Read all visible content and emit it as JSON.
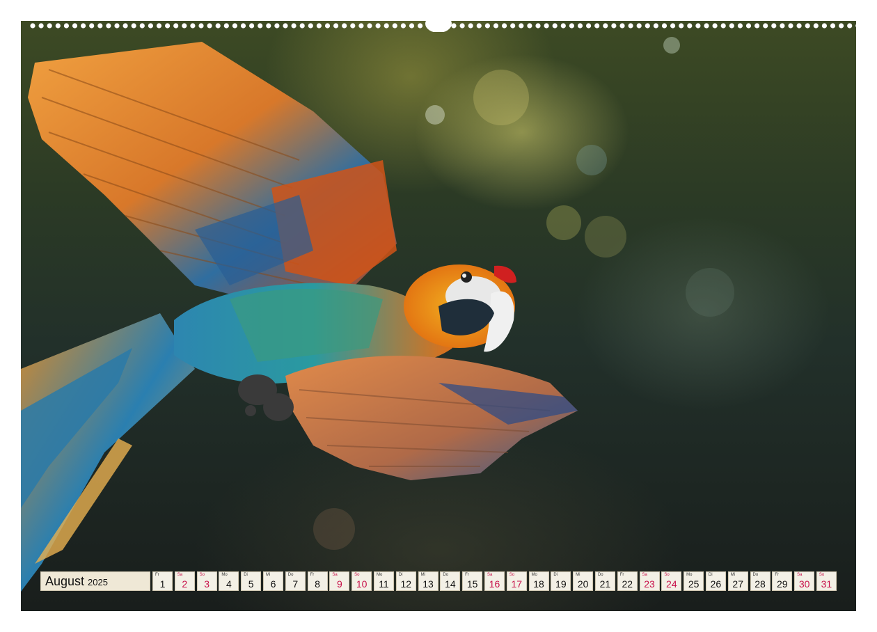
{
  "calendar": {
    "month": "August",
    "year": "2025",
    "weekend_color": "#c8104a",
    "days": [
      {
        "wd": "Fr",
        "num": "1",
        "weekend": false
      },
      {
        "wd": "Sa",
        "num": "2",
        "weekend": true
      },
      {
        "wd": "So",
        "num": "3",
        "weekend": true
      },
      {
        "wd": "Mo",
        "num": "4",
        "weekend": false
      },
      {
        "wd": "Di",
        "num": "5",
        "weekend": false
      },
      {
        "wd": "Mi",
        "num": "6",
        "weekend": false
      },
      {
        "wd": "Do",
        "num": "7",
        "weekend": false
      },
      {
        "wd": "Fr",
        "num": "8",
        "weekend": false
      },
      {
        "wd": "Sa",
        "num": "9",
        "weekend": true
      },
      {
        "wd": "So",
        "num": "10",
        "weekend": true
      },
      {
        "wd": "Mo",
        "num": "11",
        "weekend": false
      },
      {
        "wd": "Di",
        "num": "12",
        "weekend": false
      },
      {
        "wd": "Mi",
        "num": "13",
        "weekend": false
      },
      {
        "wd": "Do",
        "num": "14",
        "weekend": false
      },
      {
        "wd": "Fr",
        "num": "15",
        "weekend": false
      },
      {
        "wd": "Sa",
        "num": "16",
        "weekend": true
      },
      {
        "wd": "So",
        "num": "17",
        "weekend": true
      },
      {
        "wd": "Mo",
        "num": "18",
        "weekend": false
      },
      {
        "wd": "Di",
        "num": "19",
        "weekend": false
      },
      {
        "wd": "Mi",
        "num": "20",
        "weekend": false
      },
      {
        "wd": "Do",
        "num": "21",
        "weekend": false
      },
      {
        "wd": "Fr",
        "num": "22",
        "weekend": false
      },
      {
        "wd": "Sa",
        "num": "23",
        "weekend": true
      },
      {
        "wd": "So",
        "num": "24",
        "weekend": true
      },
      {
        "wd": "Mo",
        "num": "25",
        "weekend": false
      },
      {
        "wd": "Di",
        "num": "26",
        "weekend": false
      },
      {
        "wd": "Mi",
        "num": "27",
        "weekend": false
      },
      {
        "wd": "Do",
        "num": "28",
        "weekend": false
      },
      {
        "wd": "Fr",
        "num": "29",
        "weekend": false
      },
      {
        "wd": "Sa",
        "num": "30",
        "weekend": true
      },
      {
        "wd": "So",
        "num": "31",
        "weekend": true
      }
    ]
  }
}
